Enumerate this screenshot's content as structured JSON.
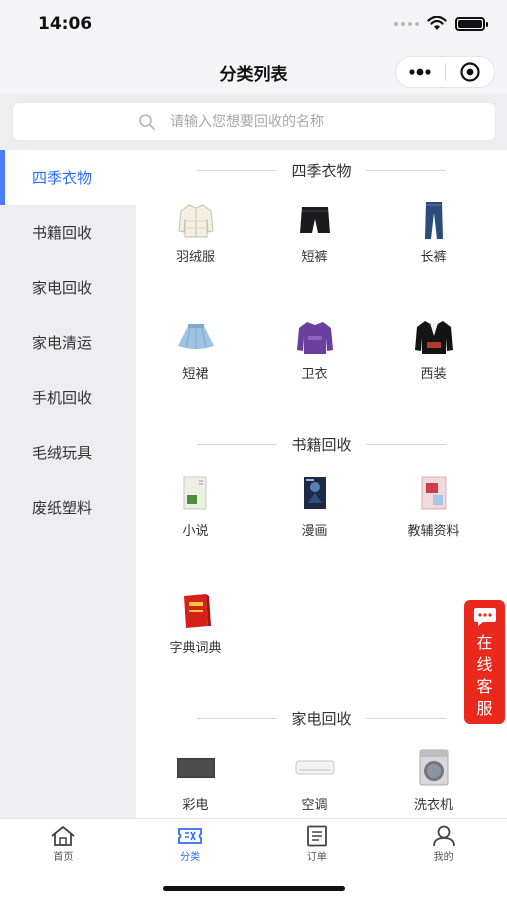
{
  "status": {
    "time": "14:06"
  },
  "nav": {
    "title": "分类列表"
  },
  "search": {
    "placeholder": "请输入您想要回收的名称"
  },
  "sidebar": {
    "items": [
      {
        "label": "四季衣物"
      },
      {
        "label": "书籍回收"
      },
      {
        "label": "家电回收"
      },
      {
        "label": "家电清运"
      },
      {
        "label": "手机回收"
      },
      {
        "label": "毛绒玩具"
      },
      {
        "label": "废纸塑料"
      }
    ]
  },
  "sections": [
    {
      "title": "四季衣物",
      "items": [
        {
          "label": "羽绒服",
          "icon": "down-jacket-icon"
        },
        {
          "label": "短裤",
          "icon": "shorts-icon"
        },
        {
          "label": "长裤",
          "icon": "jeans-icon"
        },
        {
          "label": "短裙",
          "icon": "skirt-icon"
        },
        {
          "label": "卫衣",
          "icon": "hoodie-icon"
        },
        {
          "label": "西装",
          "icon": "suit-icon"
        }
      ]
    },
    {
      "title": "书籍回收",
      "items": [
        {
          "label": "小说",
          "icon": "novel-book-icon"
        },
        {
          "label": "漫画",
          "icon": "comic-book-icon"
        },
        {
          "label": "教辅资料",
          "icon": "textbook-icon"
        },
        {
          "label": "字典词典",
          "icon": "dictionary-icon"
        }
      ]
    },
    {
      "title": "家电回收",
      "items": [
        {
          "label": "彩电",
          "icon": "tv-icon"
        },
        {
          "label": "空调",
          "icon": "air-conditioner-icon"
        },
        {
          "label": "洗衣机",
          "icon": "washing-machine-icon"
        }
      ]
    }
  ],
  "float_service": {
    "label": "在线客服"
  },
  "tabbar": {
    "tabs": [
      {
        "label": "首页"
      },
      {
        "label": "分类"
      },
      {
        "label": "订单"
      },
      {
        "label": "我的"
      }
    ]
  },
  "colors": {
    "accent": "#2f6bff",
    "service_red": "#e8291c"
  }
}
